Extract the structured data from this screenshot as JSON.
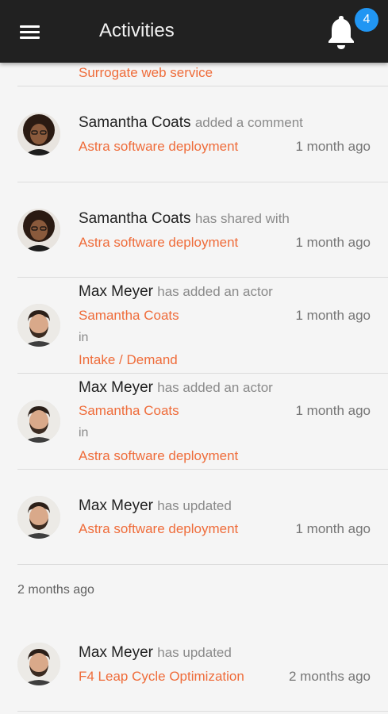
{
  "appbar": {
    "title": "Activities",
    "notification_count": "4"
  },
  "top_partial_link": "Surrogate web service",
  "activities": [
    {
      "name": "Samantha Coats",
      "action": "added a comment",
      "link": "Astra software deployment",
      "time": "1 month ago",
      "avatar": "samantha"
    },
    {
      "name": "Samantha Coats",
      "action": "has shared with",
      "link": "Astra software deployment",
      "time": "1 month ago",
      "avatar": "samantha"
    },
    {
      "name": "Max Meyer",
      "action": "has added an actor",
      "link": "Samantha Coats",
      "in_label": "in",
      "link2": "Intake / Demand",
      "time": "1 month ago",
      "avatar": "max"
    },
    {
      "name": "Max Meyer",
      "action": "has added an actor",
      "link": "Samantha Coats",
      "in_label": "in",
      "link2": "Astra software deployment",
      "time": "1 month ago",
      "avatar": "max"
    },
    {
      "name": "Max Meyer",
      "action": "has updated",
      "link": "Astra software deployment",
      "time": "1 month ago",
      "avatar": "max"
    }
  ],
  "section_header": "2 months ago",
  "older_activities": [
    {
      "name": "Max Meyer",
      "action": "has updated",
      "link": "F4 Leap Cycle Optimization",
      "time": "2 months ago",
      "avatar": "max"
    }
  ],
  "colors": {
    "appbar": "#212121",
    "badge": "#2196f3",
    "link": "#ef6c3a",
    "background": "#f5f5f5"
  }
}
